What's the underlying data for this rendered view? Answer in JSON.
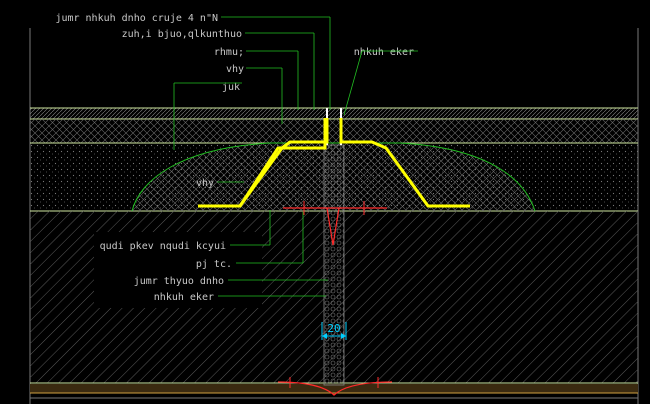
{
  "labels_top": [
    "jumr nhkuh dnho cruje 4 n\"N",
    "zuh,i bjuo,qlkunthuo",
    "rhmu;",
    "vhy",
    "juk"
  ],
  "label_right": "nhkuh eker",
  "label_fill": "vhy",
  "labels_bottom": [
    "qudi pkev nqudi kcyui",
    "pj tc.",
    "jumr thyuo dnho",
    "nhkuh eker"
  ],
  "dimension": "20",
  "colors": {
    "background": "#000000",
    "hatch": "#6e6e6e",
    "grid_lines": "#cfe8a0",
    "yellow_profile": "#ffff00",
    "red_mark": "#ff2a2a",
    "green_leader": "#22c022",
    "dim_cyan": "#00d0ff",
    "label_text": "#c8c8c8"
  }
}
